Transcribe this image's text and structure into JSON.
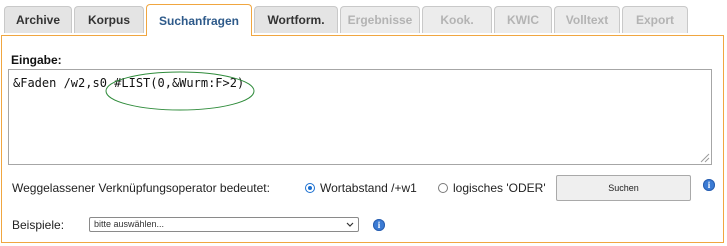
{
  "tabs": [
    {
      "label": "Archive",
      "state": "normal"
    },
    {
      "label": "Korpus",
      "state": "normal"
    },
    {
      "label": "Suchanfragen",
      "state": "active"
    },
    {
      "label": "Wortform.",
      "state": "normal"
    },
    {
      "label": "Ergebnisse",
      "state": "disabled"
    },
    {
      "label": "Kook.",
      "state": "disabled"
    },
    {
      "label": "KWIC",
      "state": "disabled"
    },
    {
      "label": "Volltext",
      "state": "disabled"
    },
    {
      "label": "Export",
      "state": "disabled"
    }
  ],
  "input": {
    "label": "Eingabe:",
    "value": "&Faden /w2,s0 #LIST(0,&Wurm:F>2)",
    "highlight_color": "#2e8b3a"
  },
  "operator": {
    "label": "Weggelassener Verknüpfungsoperator bedeutet:",
    "options": [
      {
        "label": "Wortabstand /+w1",
        "checked": true
      },
      {
        "label": "logisches 'ODER'",
        "checked": false
      }
    ]
  },
  "search_button": {
    "label": "Suchen"
  },
  "examples": {
    "label": "Beispiele:",
    "selected": "bitte auswählen..."
  },
  "colors": {
    "accent_border": "#f0a640",
    "active_tab_text": "#2e5a8a",
    "info_icon": "#3b7bd4"
  },
  "icons": [
    "info-icon",
    "chevron-down-icon",
    "resize-grip-icon"
  ]
}
